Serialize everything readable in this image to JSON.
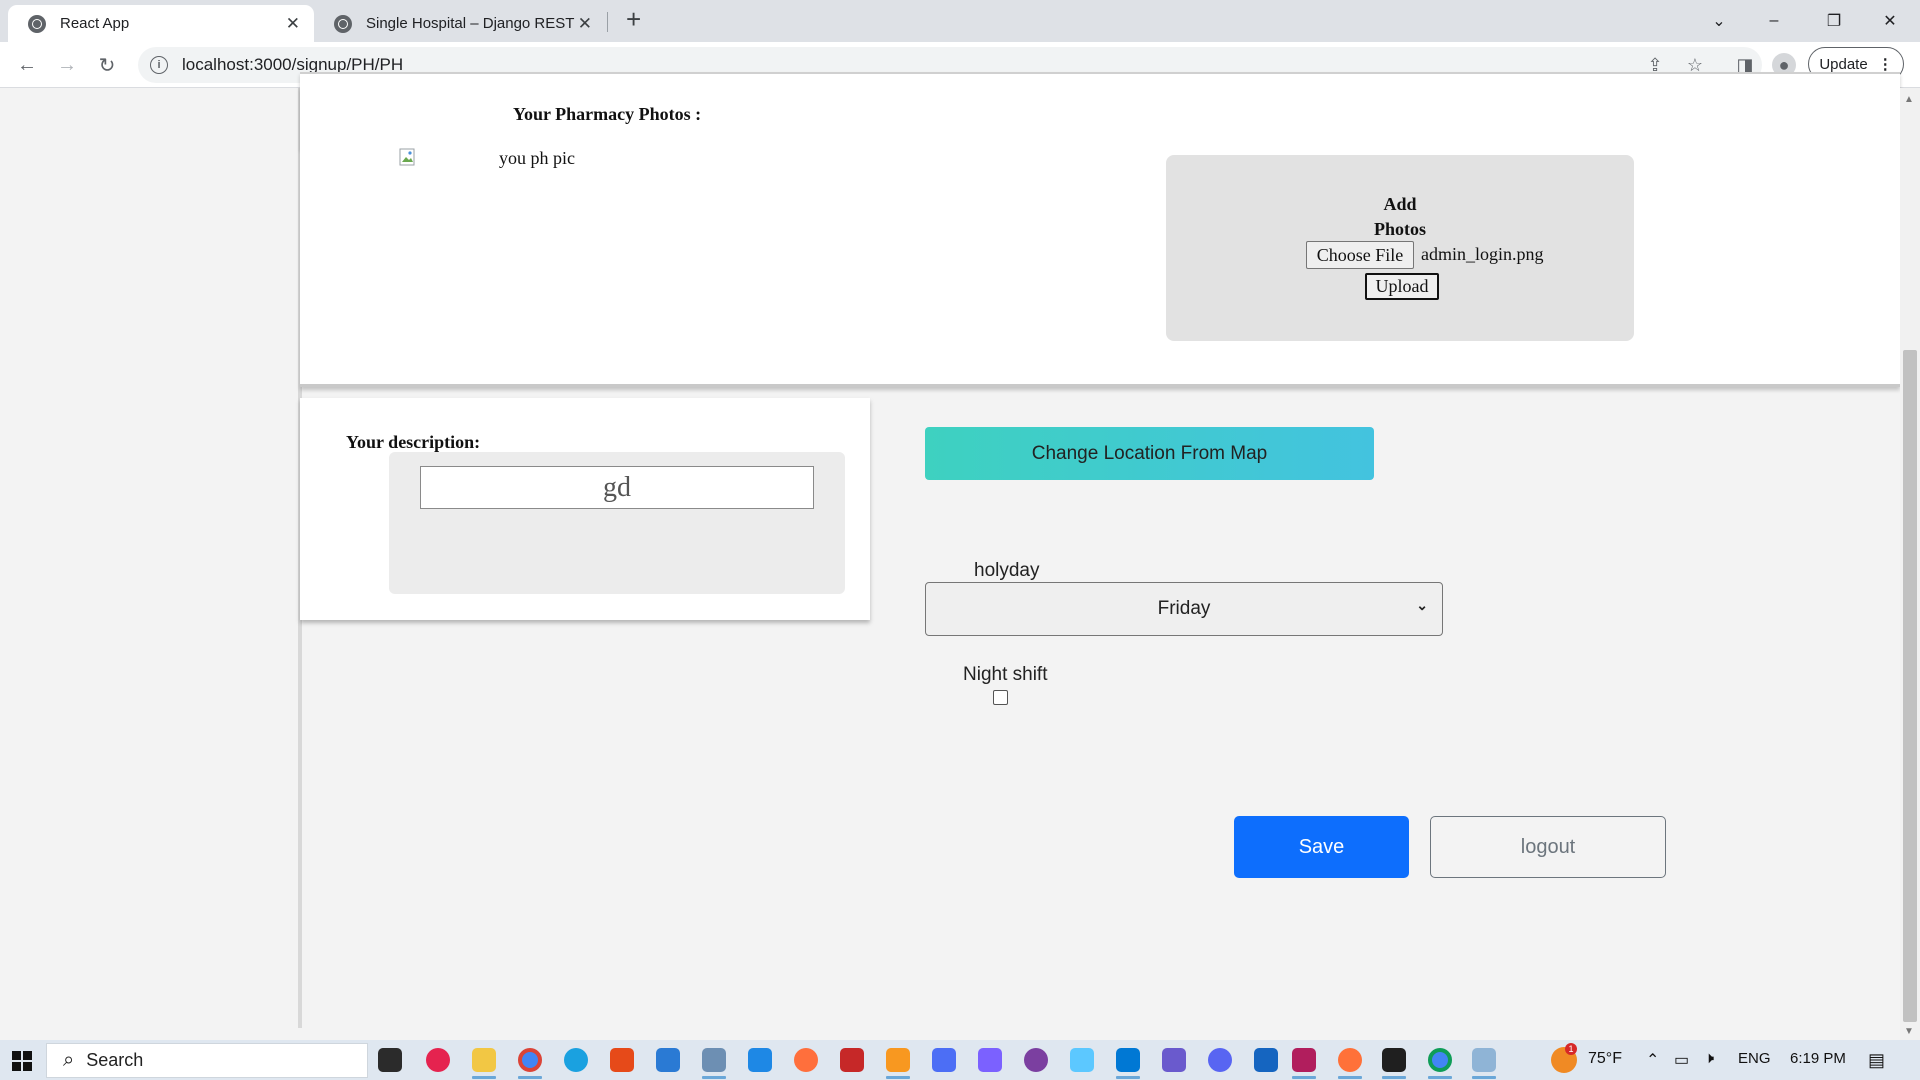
{
  "browser": {
    "tabs": [
      {
        "title": "React App",
        "active": true
      },
      {
        "title": "Single Hospital – Django REST fr",
        "active": false
      }
    ],
    "new_tab_icon": "+",
    "url": "localhost:3000/signup/PH/PH",
    "update_label": "Update"
  },
  "page": {
    "photos_title": "Your Pharmacy Photos :",
    "photo_alt": "you ph pic",
    "add_photos_label_line1": "Add",
    "add_photos_label_line2": "Photos",
    "choose_file_label": "Choose File",
    "chosen_file_name": "admin_login.png",
    "upload_label": "Upload",
    "description_label": "Your description:",
    "description_value": "gd",
    "change_location_label": "Change Location From Map",
    "holiday_label": "holyday",
    "holiday_value": "Friday",
    "night_shift_label": "Night shift",
    "night_shift_checked": false,
    "save_label": "Save",
    "logout_label": "logout"
  },
  "taskbar": {
    "search_placeholder": "Search",
    "temperature": "75°F",
    "weather_badge": "1",
    "language": "ENG",
    "time": "6:19 PM"
  },
  "colors": {
    "primary": "#0d6efd",
    "map_button_gradient_start": "#3ed1c0",
    "map_button_gradient_end": "#43c3df"
  }
}
